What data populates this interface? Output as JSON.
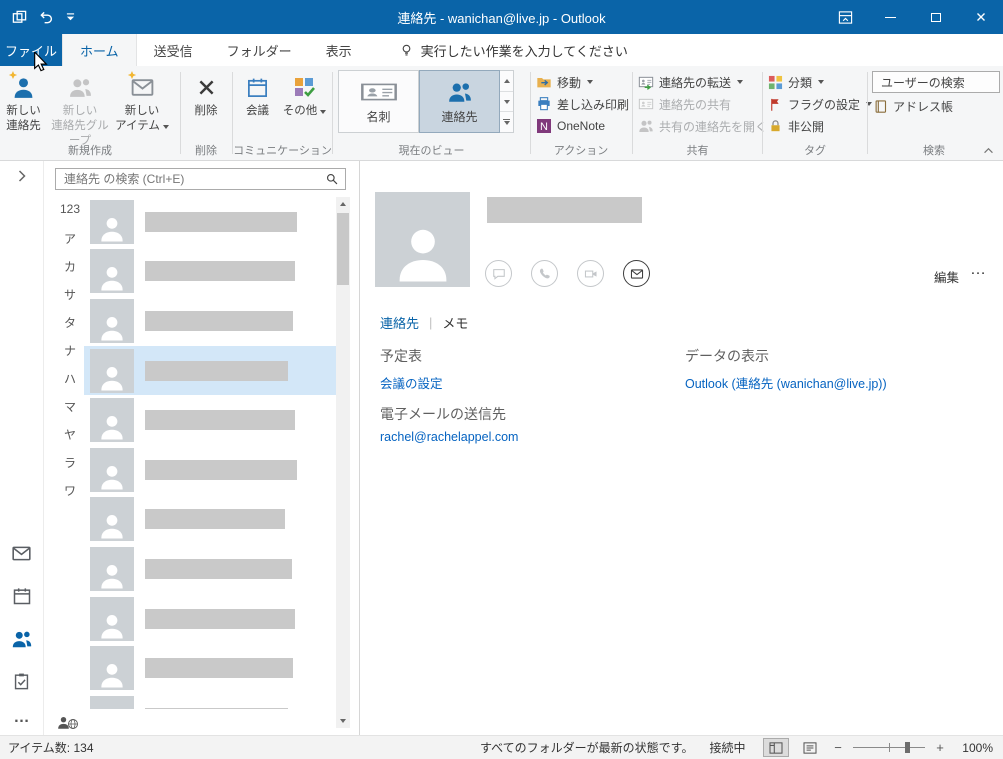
{
  "colors": {
    "titlebar": "#0a64a8",
    "accent": "#0a64a8",
    "link": "#0563c1",
    "selection": "#d3e7f8"
  },
  "titlebar": {
    "title": "連絡先 - wanichan@live.jp - Outlook"
  },
  "tabs": {
    "file": "ファイル",
    "items": [
      "ホーム",
      "送受信",
      "フォルダー",
      "表示"
    ],
    "tellme": "実行したい作業を入力してください"
  },
  "ribbon": {
    "new_contact": [
      "新しい",
      "連絡先"
    ],
    "new_contact_group": [
      "新しい",
      "連絡先グループ"
    ],
    "new_items": [
      "新しい",
      "アイテム"
    ],
    "group_new": "新規作成",
    "delete_btn": "削除",
    "group_delete": "削除",
    "meeting": "会議",
    "more": "その他",
    "group_comm": "コミュニケーション",
    "view_card": "名刺",
    "view_people": "連絡先",
    "group_view": "現在のビュー",
    "move": "移動",
    "mail_merge": "差し込み印刷",
    "onenote": "OneNote",
    "group_actions": "アクション",
    "forward": "連絡先の転送",
    "share": "連絡先の共有",
    "open_shared": "共有の連絡先を開く",
    "group_share": "共有",
    "categorize": "分類",
    "follow_up": "フラグの設定",
    "private_btn": "非公開",
    "group_tags": "タグ",
    "search_people": "ユーザーの検索",
    "address_book": "アドレス帳",
    "group_search": "検索"
  },
  "contact_list": {
    "search_placeholder": "連絡先 の検索 (Ctrl+E)",
    "index": [
      "123",
      "ア",
      "カ",
      "サ",
      "タ",
      "ナ",
      "ハ",
      "マ",
      "ヤ",
      "ラ",
      "ワ"
    ],
    "rows": [
      {
        "w": 152
      },
      {
        "w": 150
      },
      {
        "w": 148
      },
      {
        "w": 143
      },
      {
        "w": 150
      },
      {
        "w": 152
      },
      {
        "w": 140
      },
      {
        "w": 147
      },
      {
        "w": 150
      },
      {
        "w": 148
      },
      {
        "w": 143
      }
    ],
    "selected_index": 3
  },
  "reading_pane": {
    "edit": "編集",
    "more": "…",
    "tab_contact": "連絡先",
    "tab_memo": "メモ",
    "calendar_heading": "予定表",
    "calendar_link": "会議の設定",
    "source_heading": "データの表示",
    "source_link": "Outlook (連絡先 (wanichan@live.jp))",
    "email_heading": "電子メールの送信先",
    "email_link": "rachel@rachelappel.com"
  },
  "statusbar": {
    "item_count": "アイテム数: 134",
    "sync_status": "すべてのフォルダーが最新の状態です。",
    "connection": "接続中",
    "zoom": "100%"
  }
}
